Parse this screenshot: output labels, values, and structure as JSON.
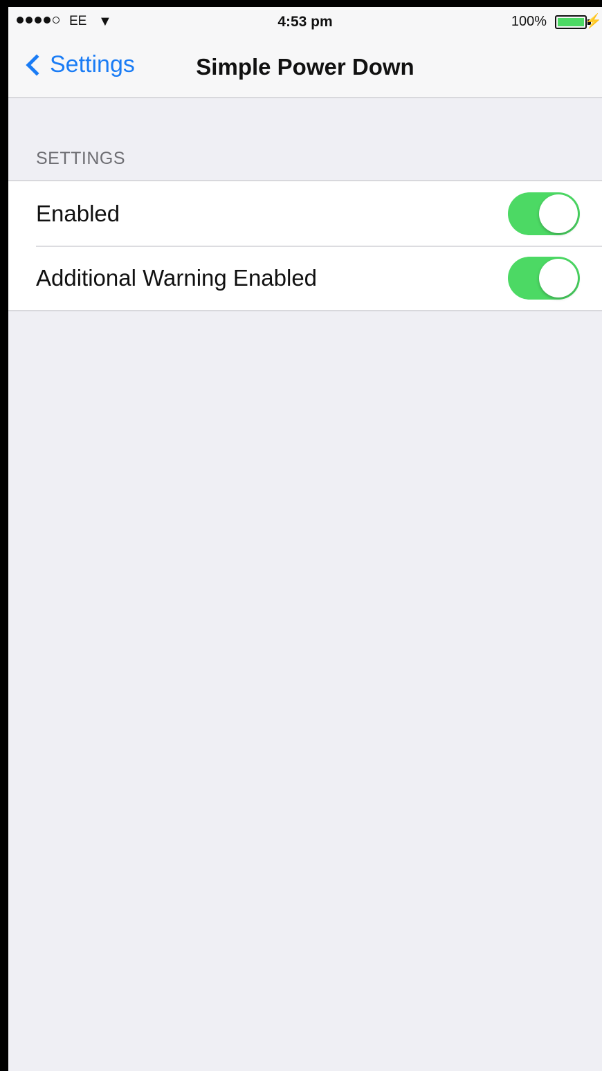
{
  "status_bar": {
    "carrier": "EE",
    "time": "4:53 pm",
    "battery_percent": "100%",
    "battery_level": 1.0,
    "signal_bars_filled": 4,
    "signal_bars_total": 5
  },
  "nav": {
    "back_label": "Settings",
    "title": "Simple Power Down"
  },
  "section": {
    "header": "SETTINGS",
    "rows": [
      {
        "label": "Enabled",
        "on": true
      },
      {
        "label": "Additional Warning Enabled",
        "on": true
      }
    ]
  },
  "colors": {
    "accent": "#1a7cf5",
    "toggle_on": "#4cd964",
    "background": "#efeff4"
  },
  "icons": {
    "back": "chevron-left-icon",
    "wifi": "wifi-icon",
    "battery": "battery-icon",
    "charging": "charging-bolt-icon"
  }
}
